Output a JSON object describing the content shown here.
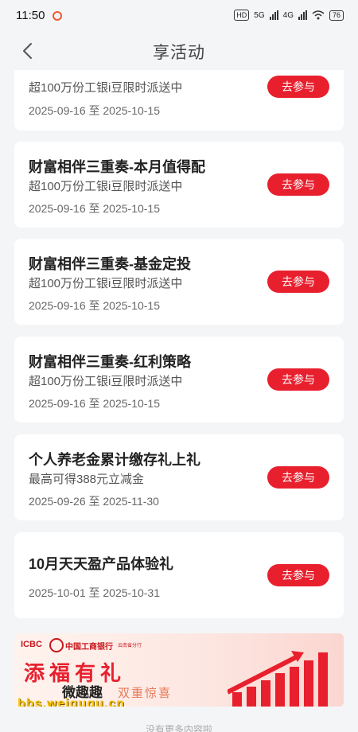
{
  "status": {
    "time": "11:50",
    "network1": "5G",
    "network2": "4G",
    "battery": "76"
  },
  "header": {
    "title": "享活动"
  },
  "activities": [
    {
      "title": "",
      "desc": "超100万份工银i豆限时派送中",
      "date": "2025-09-16 至 2025-10-15",
      "button": "去参与"
    },
    {
      "title": "财富相伴三重奏-本月值得配",
      "desc": "超100万份工银i豆限时派送中",
      "date": "2025-09-16 至 2025-10-15",
      "button": "去参与"
    },
    {
      "title": "财富相伴三重奏-基金定投",
      "desc": "超100万份工银i豆限时派送中",
      "date": "2025-09-16 至 2025-10-15",
      "button": "去参与"
    },
    {
      "title": "财富相伴三重奏-红利策略",
      "desc": "超100万份工银i豆限时派送中",
      "date": "2025-09-16 至 2025-10-15",
      "button": "去参与"
    },
    {
      "title": "个人养老金累计缴存礼上礼",
      "desc": "最高可得388元立减金",
      "date": "2025-09-26 至 2025-11-30",
      "button": "去参与"
    },
    {
      "title": "10月天天盈产品体验礼",
      "desc": "",
      "date": "2025-10-01 至 2025-10-31",
      "button": "去参与"
    }
  ],
  "banner": {
    "icbc": "ICBC",
    "bank_name": "中国工商银行",
    "branch": "云南省分行",
    "title": "添福有礼",
    "subtitle": "双重惊喜",
    "watermark_cn": "微趣趣",
    "watermark_url": "bbs.weiququ.cn"
  },
  "footer": {
    "text": "没有更多内容啦"
  },
  "colors": {
    "accent": "#e8202e",
    "background": "#f4f5f7"
  }
}
